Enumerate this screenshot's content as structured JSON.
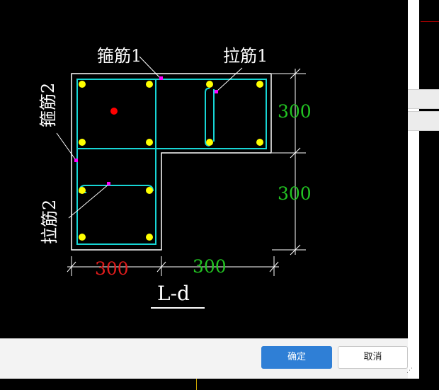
{
  "labels": {
    "stirrup1": "箍筋1",
    "tie1": "拉筋1",
    "stirrup2": "箍筋2",
    "tie2": "拉筋2",
    "section_name": "L-d"
  },
  "dimensions": {
    "right_upper": "300",
    "right_lower": "300",
    "bottom_left": "300",
    "bottom_right": "300"
  },
  "buttons": {
    "ok": "确定",
    "cancel": "取消"
  },
  "colors": {
    "stirrup": "#17d6d6",
    "rebar": "#ffff00",
    "dimension_green": "#22c322",
    "dimension_red": "#e01c1c",
    "leader_marker": "#ff00ff",
    "outline": "#ffffff",
    "ok_button": "#2f7fd6"
  }
}
